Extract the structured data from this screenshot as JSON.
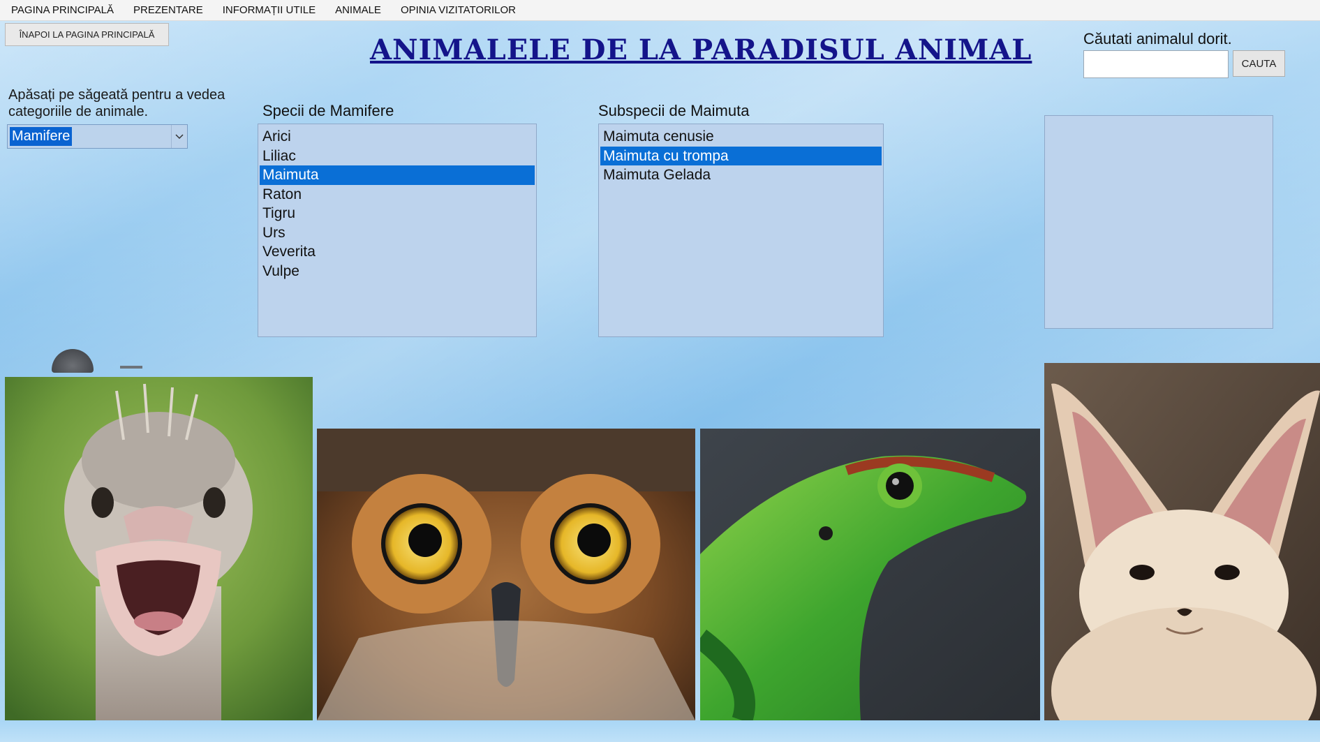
{
  "menu": {
    "items": [
      {
        "label": "PAGINA PRINCIPALĂ"
      },
      {
        "label": "PREZENTARE"
      },
      {
        "label": "INFORMAȚII UTILE"
      },
      {
        "label": "ANIMALE"
      },
      {
        "label": "OPINIA VIZITATORILOR"
      }
    ]
  },
  "back_button": {
    "label": "ÎNAPOI LA PAGINA PRINCIPALĂ"
  },
  "title": "ANIMALELE DE LA PARADISUL ANIMAL",
  "search": {
    "label": "Căutati animalul dorit.",
    "value": "",
    "button_label": "CAUTA"
  },
  "category": {
    "instructions": "Apăsați pe săgeată pentru a vedea categoriile de animale.",
    "selected": "Mamifere"
  },
  "species": {
    "label": "Specii de Mamifere",
    "items": [
      "Arici",
      "Liliac",
      "Maimuta",
      "Raton",
      "Tigru",
      "Urs",
      "Veverita",
      "Vulpe"
    ],
    "selected": "Maimuta"
  },
  "subspecies": {
    "label": "Subspecii de Maimuta",
    "items": [
      "Maimuta cenusie",
      "Maimuta cu trompa",
      "Maimuta Gelada"
    ],
    "selected": "Maimuta cu trompa"
  },
  "photos": [
    {
      "name": "ostrich-photo"
    },
    {
      "name": "owl-photo"
    },
    {
      "name": "gecko-photo"
    },
    {
      "name": "fennec-fox-photo"
    }
  ],
  "colors": {
    "selection": "#0a6fd6",
    "listbox_bg": "#bdd3ed",
    "title": "#14148a"
  }
}
